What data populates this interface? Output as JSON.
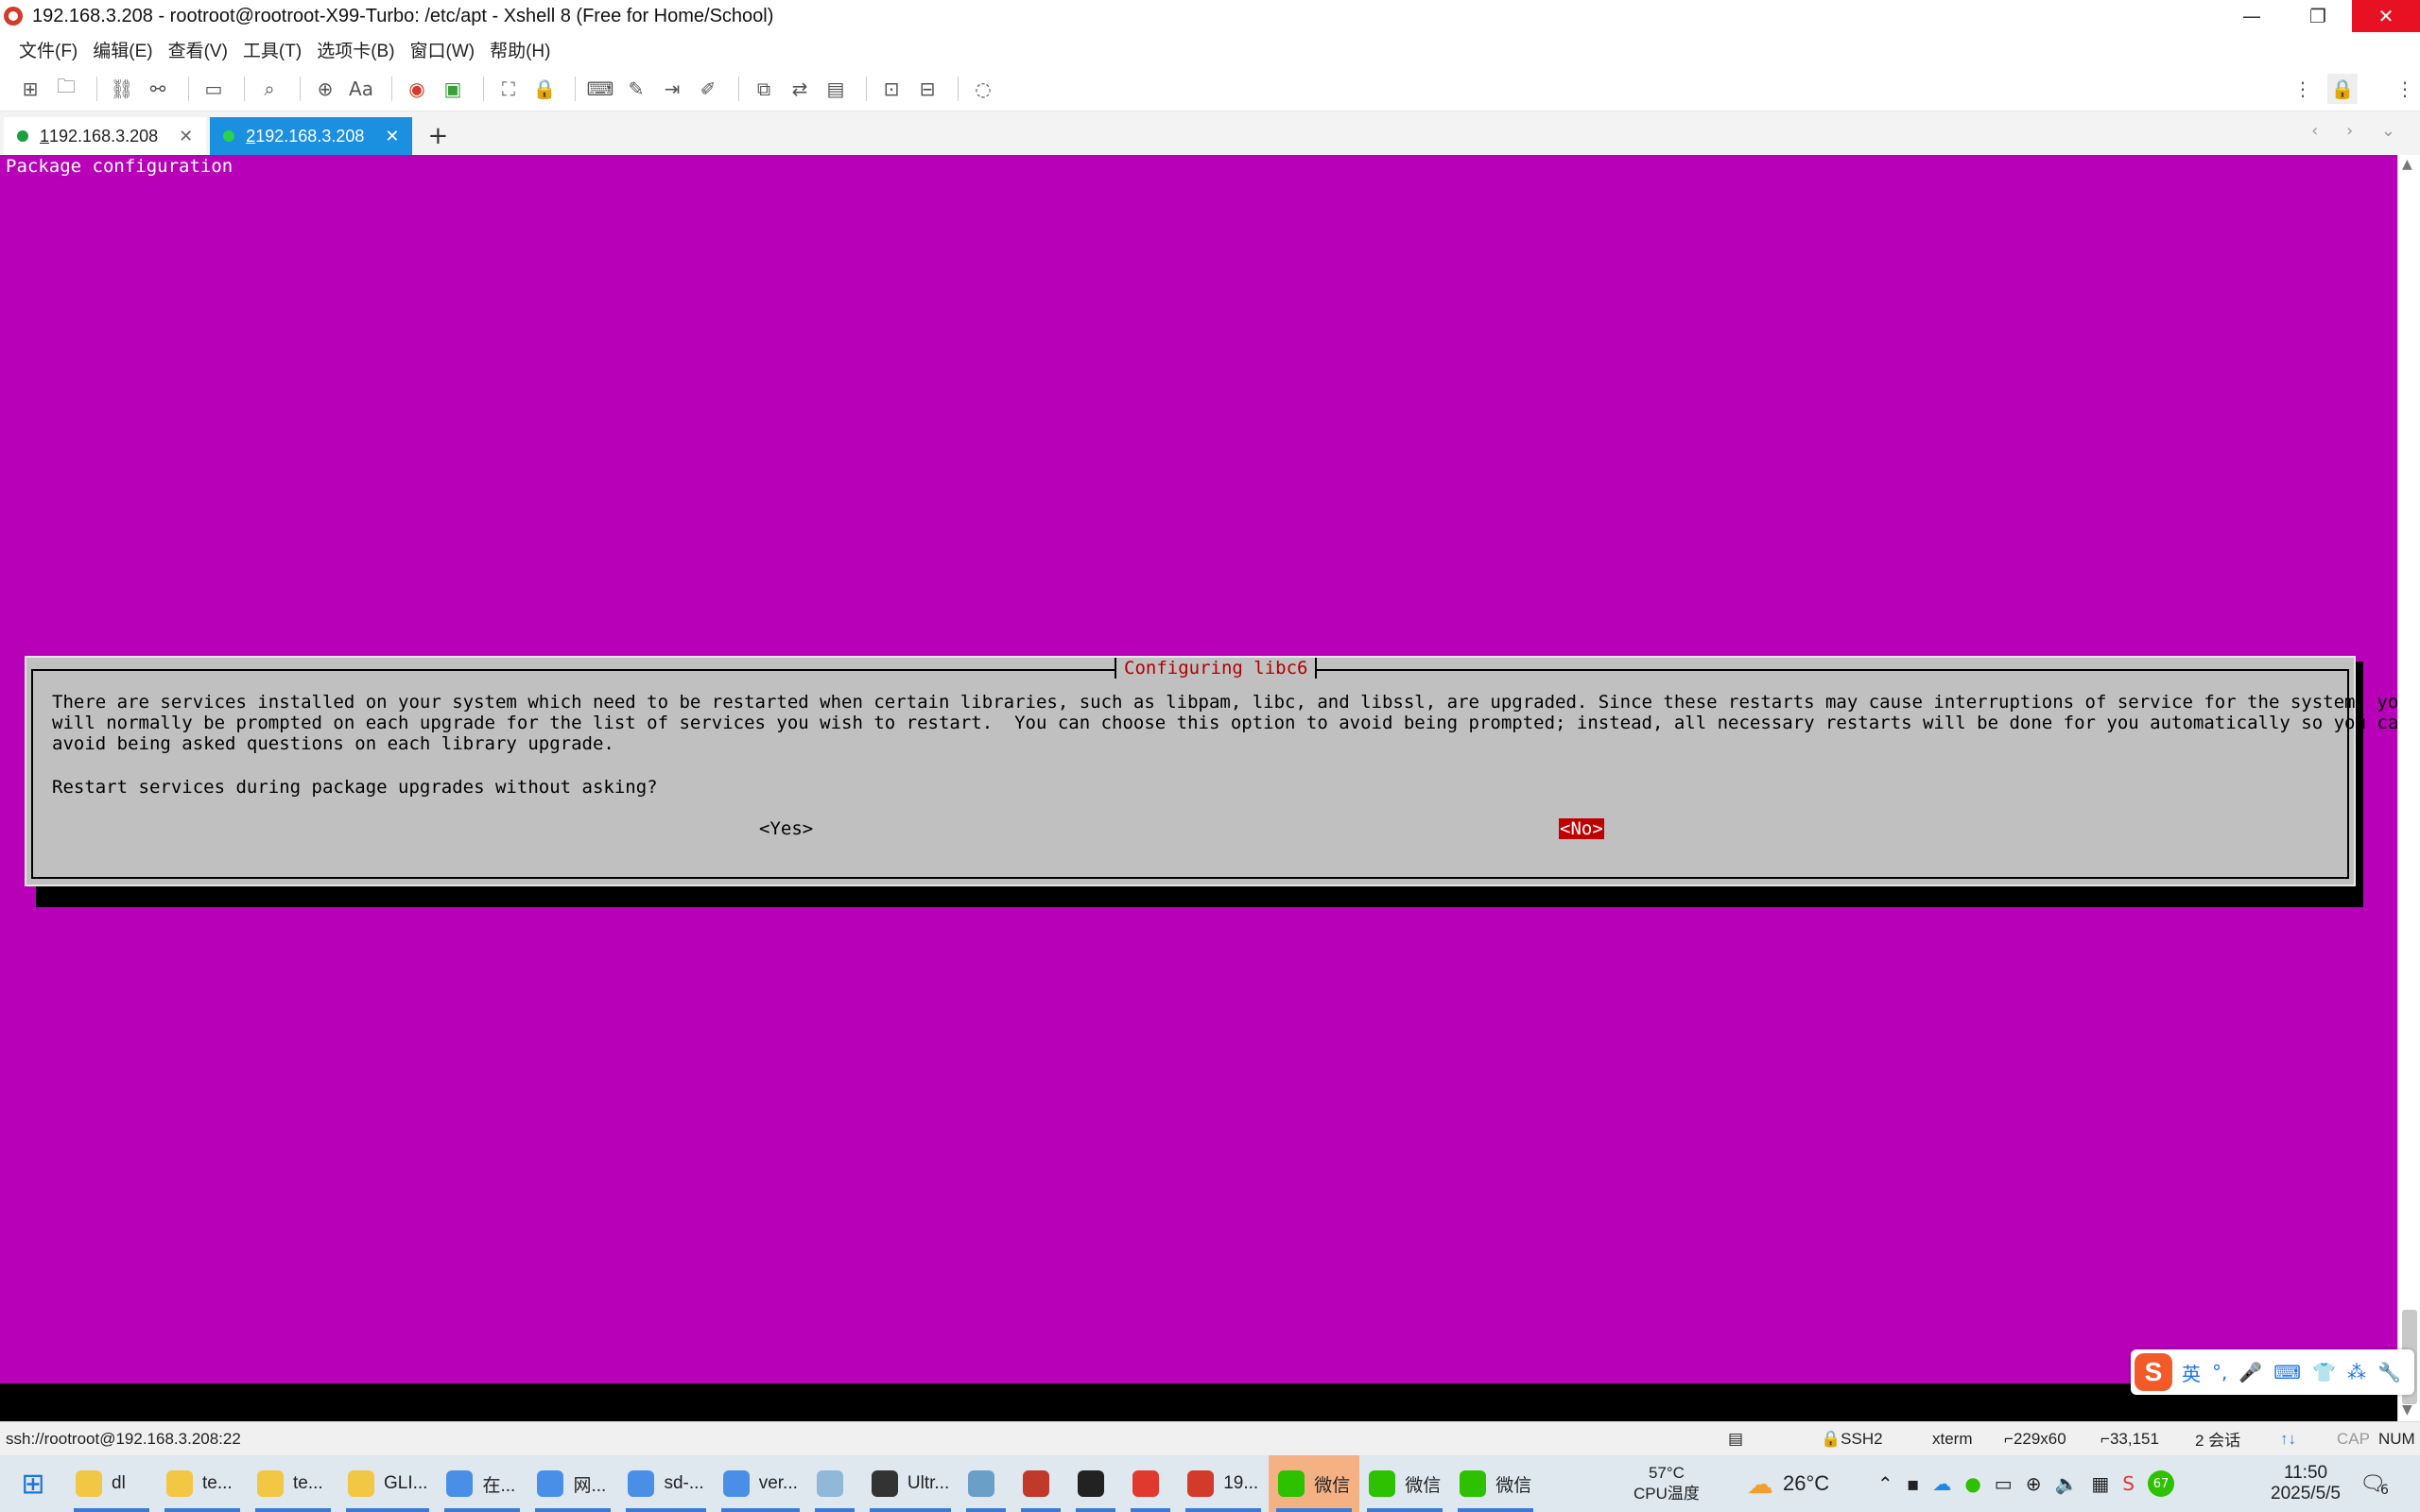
{
  "window": {
    "title": "192.168.3.208 - rootroot@rootroot-X99-Turbo: /etc/apt - Xshell 8 (Free for Home/School)",
    "controls": {
      "minimize": "—",
      "restore": "❐",
      "close": "✕"
    }
  },
  "menu": {
    "items": [
      "文件(F)",
      "编辑(E)",
      "查看(V)",
      "工具(T)",
      "选项卡(B)",
      "窗口(W)",
      "帮助(H)"
    ]
  },
  "toolbar": {
    "icons": [
      "new-session-icon",
      "open-folder-icon",
      "reconnect-icon",
      "disconnect-icon",
      "new-window-icon",
      "search-icon",
      "globe-icon",
      "font-icon",
      "xshell-icon",
      "xftp-icon",
      "fullscreen-icon",
      "lock-icon",
      "keyboard-icon",
      "highlight-icon",
      "send-icon",
      "script-icon",
      "tile-icon",
      "transfer-icon",
      "log-icon",
      "layout-icon",
      "split-icon",
      "chat-icon"
    ]
  },
  "tabs": [
    {
      "prefix": "1",
      "label": " 192.168.3.208",
      "close": "✕",
      "active": false
    },
    {
      "prefix": "2",
      "label": " 192.168.3.208",
      "close": "✕",
      "active": true
    }
  ],
  "tab_add": "+",
  "tab_nav": "‹ › ⌄",
  "terminal": {
    "background": "#b800b8",
    "heading": "Package configuration",
    "dialog": {
      "title": "Configuring libc6",
      "body": "There are services installed on your system which need to be restarted when certain libraries, such as libpam, libc, and libssl, are upgraded. Since these restarts may cause interruptions of service for the system, you\nwill normally be prompted on each upgrade for the list of services you wish to restart.  You can choose this option to avoid being prompted; instead, all necessary restarts will be done for you automatically so you can\navoid being asked questions on each library upgrade.",
      "question": "Restart services during package upgrades without asking?",
      "yes_label": "<Yes>",
      "no_label": "<No>",
      "selected": "no"
    }
  },
  "ime": {
    "logo": "S",
    "lang": "英",
    "items": [
      "°,",
      "🎤",
      "⌨",
      "👕",
      "⁂",
      "🔧"
    ]
  },
  "statusbar": {
    "connection": "ssh://rootroot@192.168.3.208:22",
    "protocol": "SSH2",
    "terminal_type": "xterm",
    "size": "229x60",
    "cursor": "33,151",
    "sessions": "2 会话",
    "cap": "CAP",
    "num": "NUM"
  },
  "taskbar": {
    "apps": [
      {
        "label": "dl",
        "color": "#f2c744"
      },
      {
        "label": "te...",
        "color": "#f2c744"
      },
      {
        "label": "te...",
        "color": "#f2c744"
      },
      {
        "label": "GLI...",
        "color": "#f2c744"
      },
      {
        "label": "在...",
        "color": "#4a8fe7"
      },
      {
        "label": "网...",
        "color": "#4a8fe7"
      },
      {
        "label": "sd-...",
        "color": "#4a8fe7"
      },
      {
        "label": "ver...",
        "color": "#4a8fe7"
      },
      {
        "label": "",
        "color": "#8fb8d9"
      },
      {
        "label": "Ultr...",
        "color": "#333333"
      },
      {
        "label": "",
        "color": "#6aa0c8"
      },
      {
        "label": "",
        "color": "#c0392b"
      },
      {
        "label": "",
        "color": "#222222"
      },
      {
        "label": "",
        "color": "#e03a2f"
      },
      {
        "label": "19...",
        "color": "#d23b2a"
      },
      {
        "label": "微信",
        "color": "#2dc100"
      },
      {
        "label": "微信",
        "color": "#2dc100"
      },
      {
        "label": "微信",
        "color": "#2dc100"
      }
    ],
    "cpu_temp": "57°C",
    "cpu_label": "CPU温度",
    "weather": "26°C",
    "battery_badge": "67",
    "time": "11:50",
    "date": "2025/5/5",
    "notifications": "6"
  }
}
